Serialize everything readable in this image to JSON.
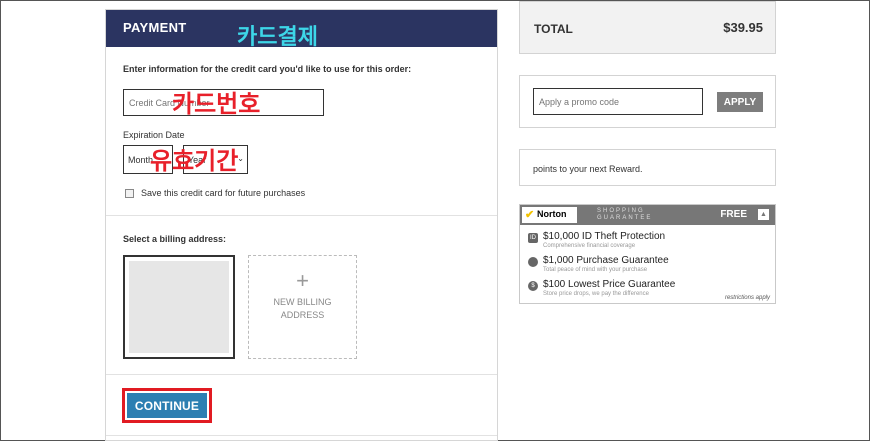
{
  "payment": {
    "title": "PAYMENT",
    "annotation_title": "카드결제",
    "instruction": "Enter information for the credit card you'd like to use for this order:",
    "card_placeholder": "Credit Card Number",
    "annotation_card": "카드번호",
    "expiration_label": "Expiration Date",
    "month_value": "Month",
    "year_value": "Year",
    "annotation_expiration": "유효기간",
    "save_card_label": "Save this credit card for future purchases",
    "billing_label": "Select a billing address:",
    "new_address_label": "NEW BILLING ADDRESS",
    "continue_label": "CONTINUE"
  },
  "summary": {
    "total_label": "TOTAL",
    "total_value": "$39.95",
    "promo_placeholder": "Apply a promo code",
    "apply_label": "APPLY",
    "reward_text": "points to your next Reward."
  },
  "norton": {
    "logo_text": "Norton",
    "shopping_guarantee": "SHOPPING GUARANTEE",
    "free_label": "FREE",
    "items": [
      {
        "title": "$10,000 ID Theft Protection",
        "sub": "Comprehensive financial coverage"
      },
      {
        "title": "$1,000 Purchase Guarantee",
        "sub": "Total peace of mind with your purchase"
      },
      {
        "title": "$100 Lowest Price Guarantee",
        "sub": "Store price drops, we pay the difference"
      }
    ],
    "restrictions": "restrictions apply"
  },
  "colors": {
    "header_navy": "#2b3461",
    "continue_blue": "#2c7fb2",
    "highlight_red": "#e11b22",
    "annotation_cyan": "#3dd6e8",
    "annotation_red": "#e8202a"
  }
}
